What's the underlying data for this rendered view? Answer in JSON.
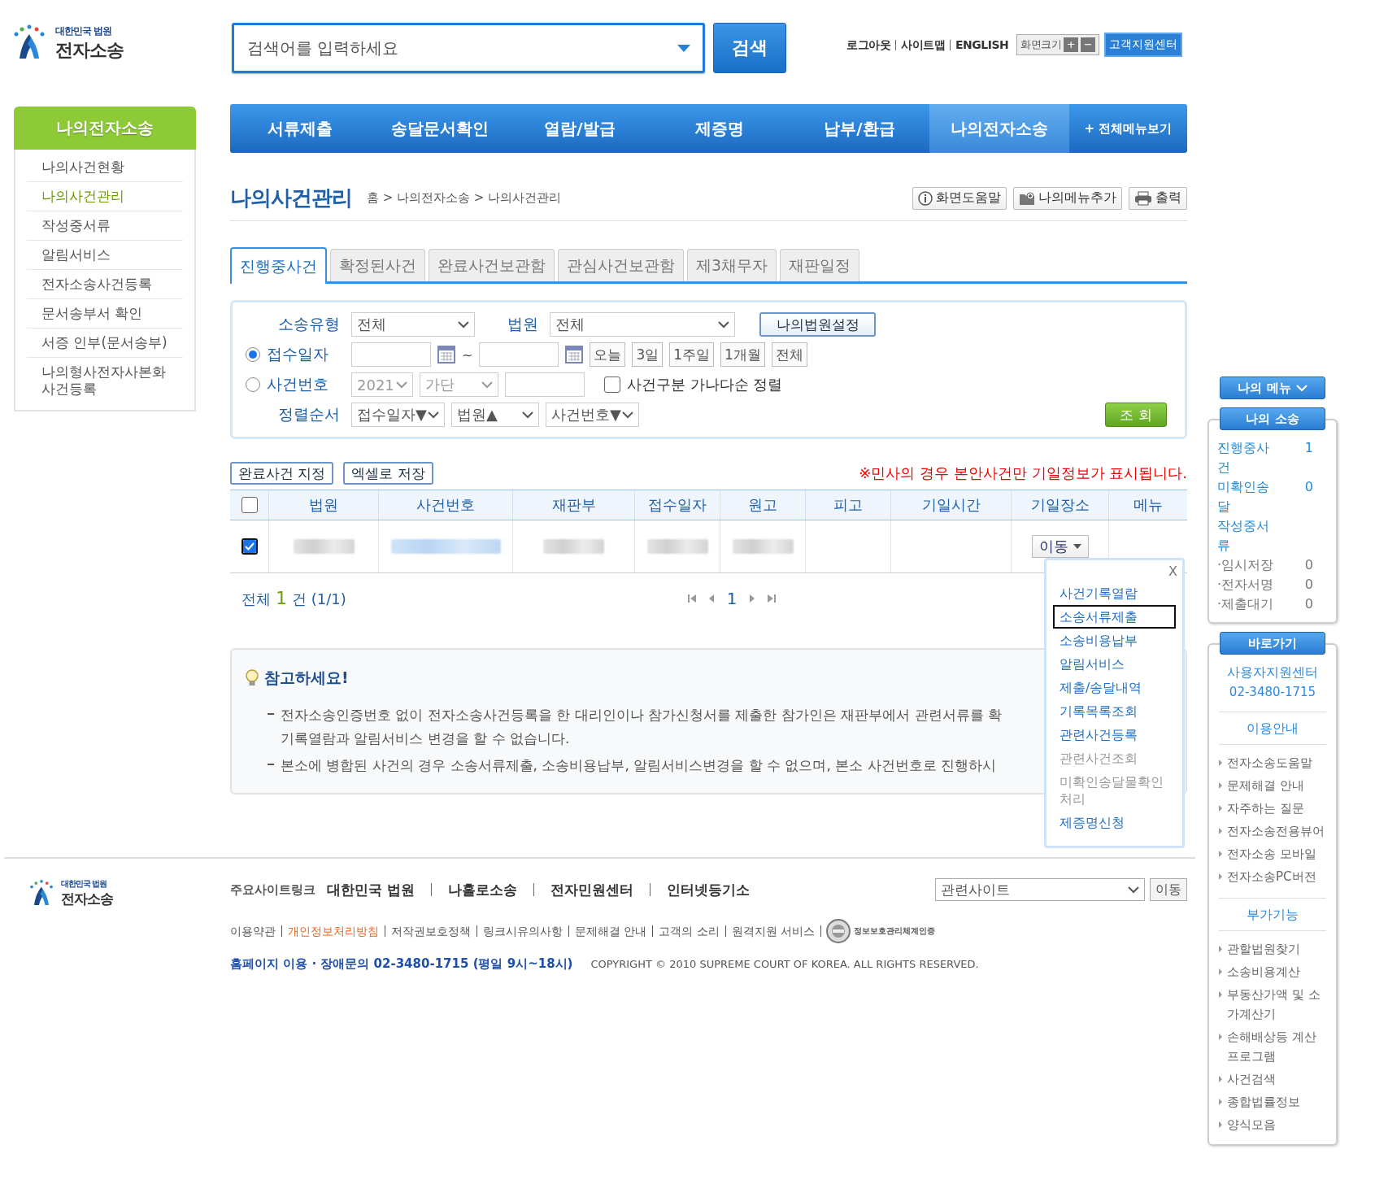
{
  "header": {
    "logo": {
      "line1": "대한민국 법원",
      "line2": "전자소송"
    },
    "search": {
      "placeholder": "검색어를 입력하세요",
      "button": "검색"
    },
    "links": [
      "로그아웃",
      "사이트맵",
      "ENGLISH"
    ],
    "font_size": {
      "label": "화면크기",
      "plus": "+",
      "minus": "−"
    },
    "support": "고객지원센터"
  },
  "nav": {
    "items": [
      {
        "label": "서류제출",
        "selected": false
      },
      {
        "label": "송달문서확인",
        "selected": false
      },
      {
        "label": "열람/발급",
        "selected": false
      },
      {
        "label": "제증명",
        "selected": false
      },
      {
        "label": "납부/환급",
        "selected": false
      },
      {
        "label": "나의전자소송",
        "selected": true
      }
    ],
    "all_menu": "+ 전체메뉴보기"
  },
  "sidebar": {
    "title": "나의전자소송",
    "items": [
      {
        "label": "나의사건현황",
        "selected": false
      },
      {
        "label": "나의사건관리",
        "selected": true
      },
      {
        "label": "작성중서류",
        "selected": false
      },
      {
        "label": "알림서비스",
        "selected": false
      },
      {
        "label": "전자소송사건등록",
        "selected": false
      },
      {
        "label": "문서송부서 확인",
        "selected": false
      },
      {
        "label": "서증 인부(문서송부)",
        "selected": false
      },
      {
        "label": "나의형사전자사본화 사건등록",
        "selected": false
      }
    ]
  },
  "page": {
    "title": "나의사건관리",
    "breadcrumb": "홈 > 나의전자소송 > 나의사건관리",
    "tools": [
      {
        "label": "화면도움말",
        "kind": "help"
      },
      {
        "label": "나의메뉴추가",
        "kind": "add"
      },
      {
        "label": "출력",
        "kind": "print"
      }
    ]
  },
  "tabs": [
    {
      "label": "진행중사건",
      "selected": true
    },
    {
      "label": "확정된사건",
      "selected": false
    },
    {
      "label": "완료사건보관함",
      "selected": false
    },
    {
      "label": "관심사건보관함",
      "selected": false
    },
    {
      "label": "제3채무자",
      "selected": false
    },
    {
      "label": "재판일정",
      "selected": false
    }
  ],
  "filter": {
    "case_type": {
      "label": "소송유형",
      "value": "전체"
    },
    "court": {
      "label": "법원",
      "value": "전체"
    },
    "my_court_button": "나의법원설정",
    "date": {
      "label": "접수일자",
      "selected": true,
      "separator": "~",
      "quick": [
        "오늘",
        "3일",
        "1주일",
        "1개월",
        "전체"
      ]
    },
    "case_no": {
      "label": "사건번호",
      "selected": false,
      "year": "2021",
      "type": "가단",
      "sort_check": {
        "label": "사건구분 가나다순 정렬",
        "checked": false
      }
    },
    "sort": {
      "label": "정렬순서",
      "options": [
        "접수일자▼",
        "법원▲",
        "사건번호▼"
      ]
    },
    "search_button": "조 회"
  },
  "actions": [
    "완료사건 지정",
    "엑셀로 저장"
  ],
  "notice": "※민사의 경우 본안사건만 기일정보가 표시됩니다.",
  "table": {
    "header_checked": false,
    "columns": [
      "법원",
      "사건번호",
      "재판부",
      "접수일자",
      "원고",
      "피고",
      "기일시간",
      "기일장소",
      "메뉴"
    ],
    "rows": [
      {
        "checked": true,
        "cells": [
          {
            "kind": "blurred"
          },
          {
            "kind": "blurred-link"
          },
          {
            "kind": "blurred"
          },
          {
            "kind": "blurred"
          },
          {
            "kind": "blurred"
          },
          {
            "kind": "empty"
          },
          {
            "kind": "empty"
          },
          {
            "kind": "menu",
            "label": "이동"
          }
        ]
      }
    ]
  },
  "pagination": {
    "prefix": "전체",
    "count": "1",
    "suffix": "건 (1/1)",
    "page": "1"
  },
  "row_menu": {
    "close": "X",
    "items": [
      {
        "label": "사건기록열람",
        "selected": false,
        "disabled": false
      },
      {
        "label": "소송서류제출",
        "selected": true,
        "disabled": false
      },
      {
        "label": "소송비용납부",
        "selected": false,
        "disabled": false
      },
      {
        "label": "알림서비스",
        "selected": false,
        "disabled": false
      },
      {
        "label": "제출/송달내역",
        "selected": false,
        "disabled": false
      },
      {
        "label": "기록목록조회",
        "selected": false,
        "disabled": false
      },
      {
        "label": "관련사건등록",
        "selected": false,
        "disabled": false
      },
      {
        "label": "관련사건조회",
        "selected": false,
        "disabled": true
      },
      {
        "label": "미확인송달물확인처리",
        "selected": false,
        "disabled": true
      },
      {
        "label": "제증명신청",
        "selected": false,
        "disabled": false
      }
    ]
  },
  "note": {
    "title": "참고하세요!",
    "items": [
      [
        "전자소송인증번호 없이 전자소송사건등록을 한 대리인이나 참가신청서를 제출한 참가인은 재판부에서 관련서류를 확",
        "기록열람과 알림서비스 변경을 할 수 없습니다."
      ],
      [
        "본소에 병합된 사건의 경우 소송서류제출, 소송비용납부, 알림서비스변경을 할 수 없으며, 본소 사건번호로 진행하시"
      ]
    ]
  },
  "right_panel": {
    "my_menu": "나의 메뉴",
    "my_case": {
      "title": "나의 소송",
      "items": [
        {
          "label": "진행중사건",
          "count": "1",
          "kind": "main"
        },
        {
          "label": "미확인송달",
          "count": "0",
          "kind": "main"
        },
        {
          "label": "작성중서류",
          "kind": "main"
        },
        {
          "label": "·임시저장",
          "count": "0",
          "kind": "sub"
        },
        {
          "label": "·전자서명",
          "count": "0",
          "kind": "sub"
        },
        {
          "label": "·제출대기",
          "count": "0",
          "kind": "sub"
        }
      ]
    },
    "shortcuts": {
      "title": "바로가기",
      "support": "사용자지원센터",
      "phone": "02-3480-1715",
      "sections": [
        {
          "title": "이용안내",
          "links": [
            "전자소송도움말",
            "문제해결 안내",
            "자주하는 질문",
            "전자소송전용뷰어",
            "전자소송 모바일",
            "전자소송PC버전"
          ]
        },
        {
          "title": "부가기능",
          "links": [
            "관할법원찾기",
            "소송비용계산",
            "부동산가액 및 소가계산기",
            "손해배상등 계산 프로그램",
            "사건검색",
            "종합법률정보",
            "양식모음"
          ]
        }
      ]
    }
  },
  "footer": {
    "logo": {
      "line1": "대한민국 법원",
      "line2": "전자소송"
    },
    "sites_label": "주요사이트링크",
    "sites": [
      "대한민국 법원",
      "나홀로소송",
      "전자민원센터",
      "인터넷등기소"
    ],
    "related": {
      "value": "관련사이트",
      "button": "이동"
    },
    "links": [
      {
        "label": "이용약관",
        "highlight": false
      },
      {
        "label": "개인정보처리방침",
        "highlight": true
      },
      {
        "label": "저작권보호정책",
        "highlight": false
      },
      {
        "label": "링크시유의사항",
        "highlight": false
      },
      {
        "label": "문제해결 안내",
        "highlight": false
      },
      {
        "label": "고객의 소리",
        "highlight": false
      },
      {
        "label": "원격지원 서비스",
        "highlight": false
      }
    ],
    "cert": "정보보호관리체계인증",
    "contact": "홈페이지 이용 · 장애문의 02-3480-1715 (평일 9시~18시)",
    "copyright": "COPYRIGHT © 2010 SUPREME COURT OF KOREA. ALL RIGHTS RESERVED."
  }
}
